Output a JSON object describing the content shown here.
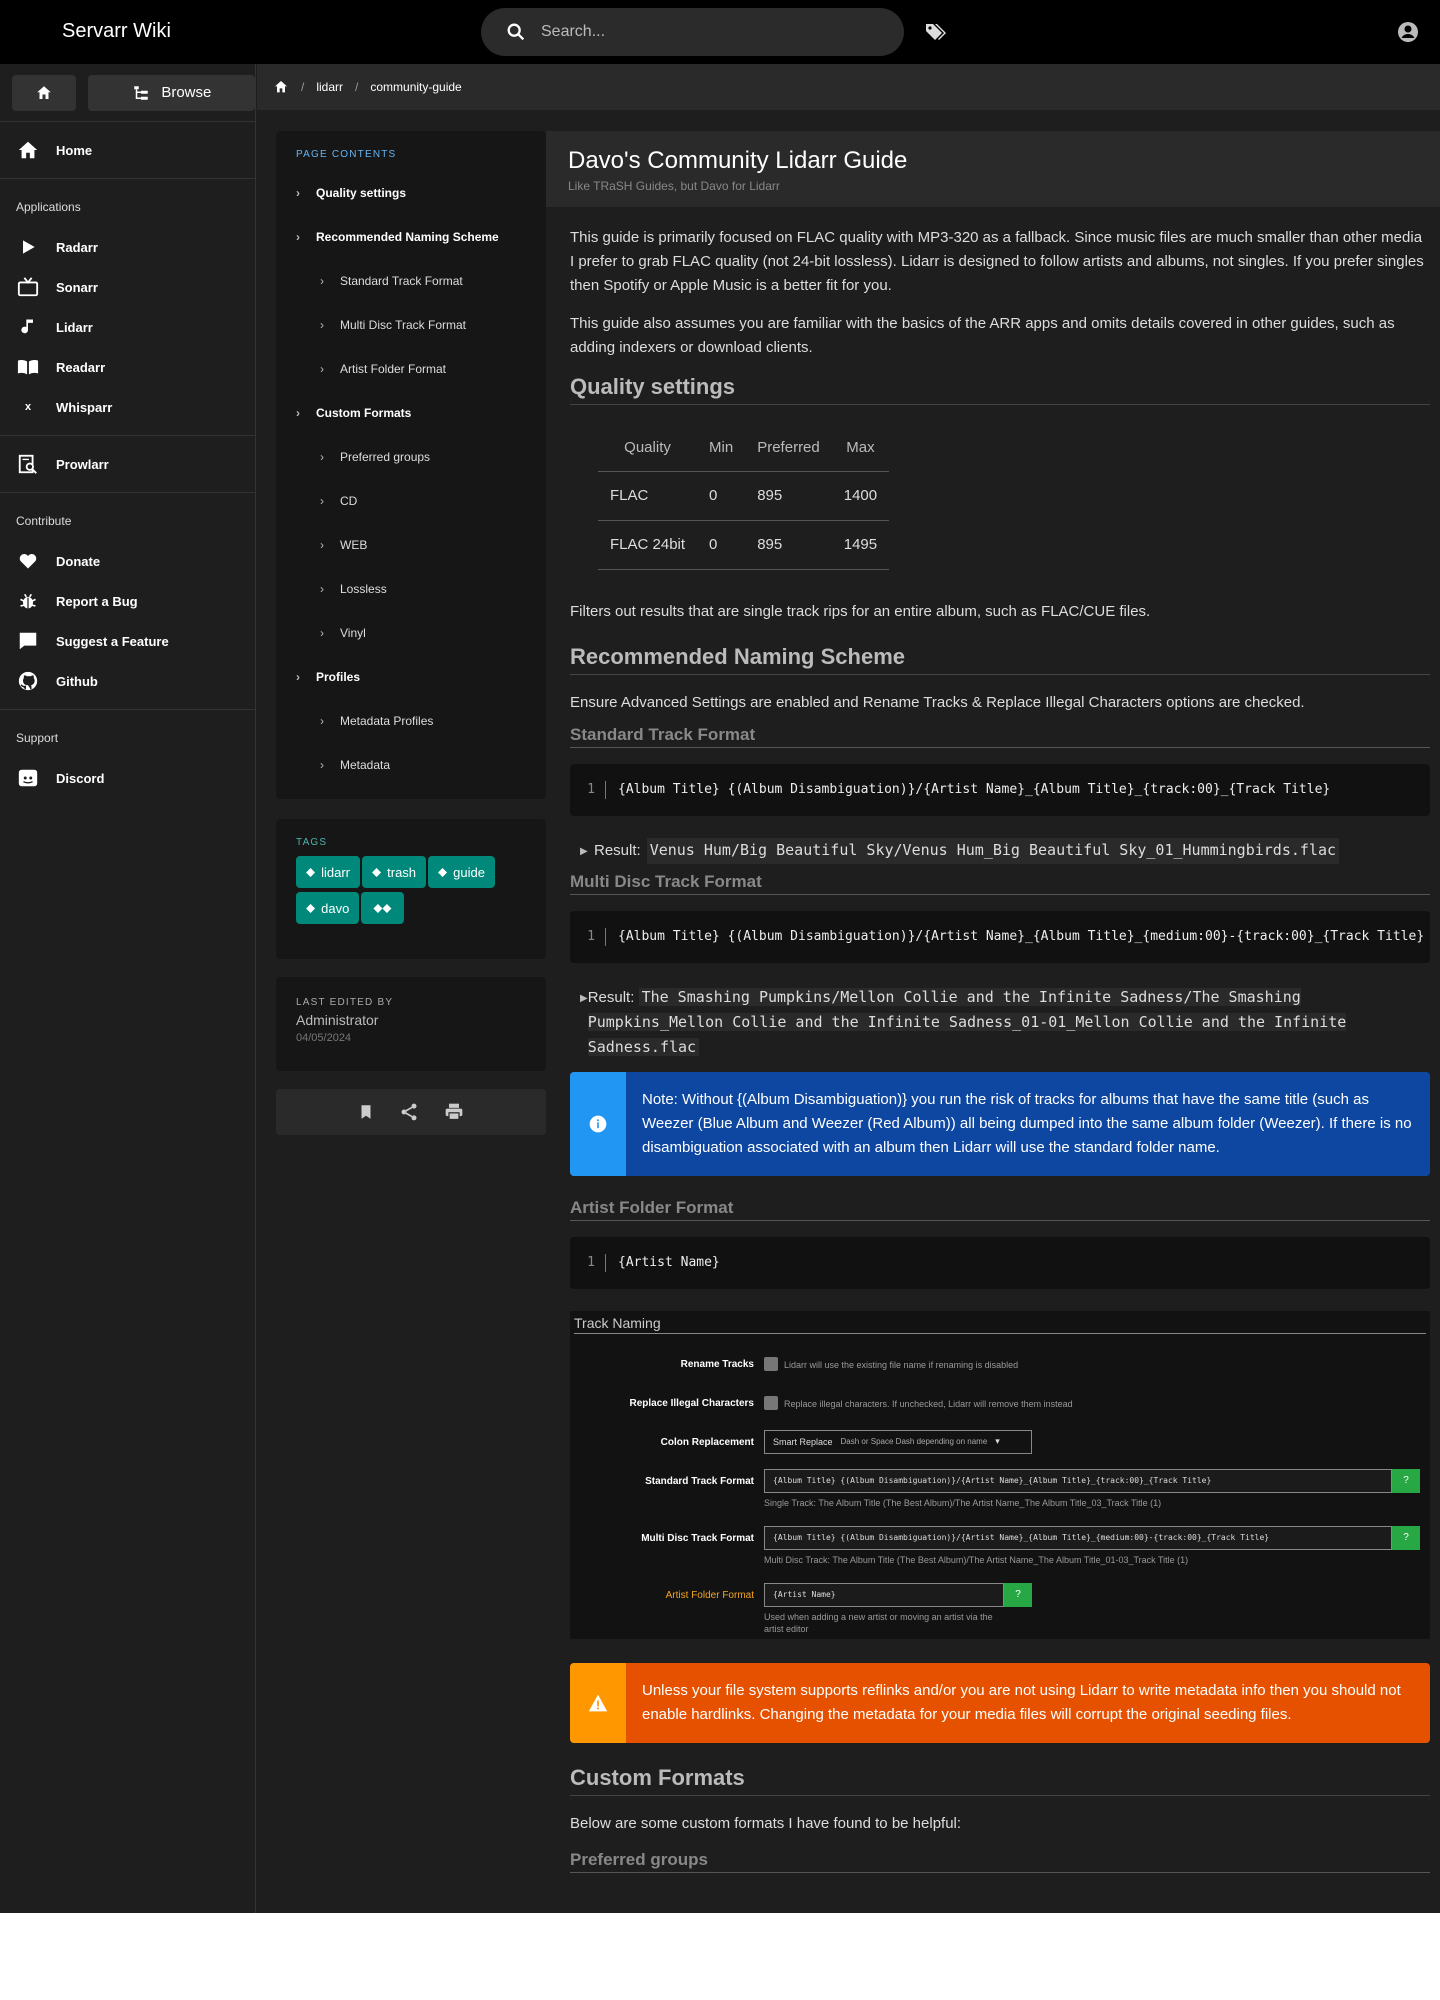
{
  "header": {
    "brand": "Servarr Wiki",
    "search_placeholder": "Search..."
  },
  "sidebar": {
    "browse_label": "Browse",
    "home": "Home",
    "section_applications": "Applications",
    "apps": [
      "Radarr",
      "Sonarr",
      "Lidarr",
      "Readarr",
      "Whisparr"
    ],
    "prowlarr": "Prowlarr",
    "section_contribute": "Contribute",
    "contribute": [
      "Donate",
      "Report a Bug",
      "Suggest a Feature",
      "Github"
    ],
    "section_support": "Support",
    "discord": "Discord"
  },
  "breadcrumb": [
    "lidarr",
    "community-guide"
  ],
  "toc": {
    "heading": "PAGE CONTENTS",
    "items": [
      {
        "label": "Quality settings"
      },
      {
        "label": "Recommended Naming Scheme"
      },
      {
        "label": "Standard Track Format"
      },
      {
        "label": "Multi Disc Track Format"
      },
      {
        "label": "Artist Folder Format"
      },
      {
        "label": "Custom Formats"
      },
      {
        "label": "Preferred groups"
      },
      {
        "label": "CD"
      },
      {
        "label": "WEB"
      },
      {
        "label": "Lossless"
      },
      {
        "label": "Vinyl"
      },
      {
        "label": "Profiles"
      },
      {
        "label": "Metadata Profiles"
      },
      {
        "label": "Metadata"
      }
    ]
  },
  "tags": {
    "heading": "TAGS",
    "items": [
      "lidarr",
      "trash",
      "guide",
      "davo"
    ]
  },
  "last_edited": {
    "heading": "LAST EDITED BY",
    "name": "Administrator",
    "date": "04/05/2024"
  },
  "page": {
    "title": "Davo's Community Lidarr Guide",
    "subtitle": "Like TRaSH Guides, but Davo for Lidarr",
    "intro1": "This guide is primarily focused on FLAC quality with MP3-320 as a fallback. Since music files are much smaller than other media I prefer to grab FLAC quality (not 24-bit lossless). Lidarr is designed to follow artists and albums, not singles. If you prefer singles then Spotify or Apple Music is a better fit for you.",
    "intro2": "This guide also assumes you are familiar with the basics of the ARR apps and omits details covered in other guides, such as adding indexers or download clients.",
    "quality_heading": "Quality settings",
    "quality_table": {
      "headers": [
        "Quality",
        "Min",
        "Preferred",
        "Max"
      ],
      "rows": [
        [
          "FLAC",
          "0",
          "895",
          "1400"
        ],
        [
          "FLAC 24bit",
          "0",
          "895",
          "1495"
        ]
      ]
    },
    "filters_text": "Filters out results that are single track rips for an entire album, such as FLAC/CUE files.",
    "naming_heading": "Recommended Naming Scheme",
    "naming_text": "Ensure Advanced Settings are enabled and Rename Tracks & Replace Illegal Characters options are checked.",
    "std_heading": "Standard Track Format",
    "std_code": "{Album Title} {(Album Disambiguation)}/{Artist Name}_{Album Title}_{track:00}_{Track Title}",
    "result_label": "Result:",
    "std_result": "Venus Hum/Big Beautiful Sky/Venus Hum_Big Beautiful Sky_01_Hummingbirds.flac",
    "multi_heading": "Multi Disc Track Format",
    "multi_code": "{Album Title} {(Album Disambiguation)}/{Artist Name}_{Album Title}_{medium:00}-{track:00}_{Track Title}",
    "multi_result": "The Smashing Pumpkins/Mellon Collie and the Infinite Sadness/The Smashing Pumpkins_Mellon Collie and the Infinite Sadness_01-01_Mellon Collie and the Infinite Sadness.flac",
    "note": "Note: Without {(Album Disambiguation)} you run the risk of tracks for albums that have the same title (such as Weezer (Blue Album and Weezer (Red Album)) all being dumped into the same album folder (Weezer). If there is no disambiguation associated with an album then Lidarr will use the standard folder name.",
    "artist_heading": "Artist Folder Format",
    "artist_code": "{Artist Name}",
    "line_number": "1",
    "screenshot": {
      "title": "Track Naming",
      "rename_label": "Rename Tracks",
      "rename_hint": "Lidarr will use the existing file name if renaming is disabled",
      "replace_label": "Replace Illegal Characters",
      "replace_hint": "Replace illegal characters. If unchecked, Lidarr will remove them instead",
      "colon_label": "Colon Replacement",
      "colon_value": "Smart Replace",
      "colon_desc": "Dash or Space Dash depending on name",
      "std_label": "Standard Track Format",
      "std_value": "{Album Title} {(Album Disambiguation)}/{Artist Name}_{Album Title}_{track:00}_{Track Title}",
      "std_hint": "Single Track: The Album Title (The Best Album)/The Artist Name_The Album Title_03_Track Title (1)",
      "multi_label": "Multi Disc Track Format",
      "multi_value": "{Album Title} {(Album Disambiguation)}/{Artist Name}_{Album Title}_{medium:00}-{track:00}_{Track Title}",
      "multi_hint": "Multi Disc Track: The Album Title (The Best Album)/The Artist Name_The Album Title_01-03_Track Title (1)",
      "artist_label": "Artist Folder Format",
      "artist_value": "{Artist Name}",
      "artist_hint1": "Used when adding a new artist or moving an artist via the",
      "artist_hint2": "artist editor",
      "help": "?"
    },
    "warning": "Unless your file system supports reflinks and/or you are not using Lidarr to write metadata info then you should not enable hardlinks. Changing the metadata for your media files will corrupt the original seeding files.",
    "custom_heading": "Custom Formats",
    "custom_text": "Below are some custom formats I have found to be helpful:",
    "preferred_heading": "Preferred groups"
  },
  "colors": {
    "accent_teal": "#00897b",
    "info_blue": "#0d47a1",
    "warn_orange": "#e65100"
  }
}
